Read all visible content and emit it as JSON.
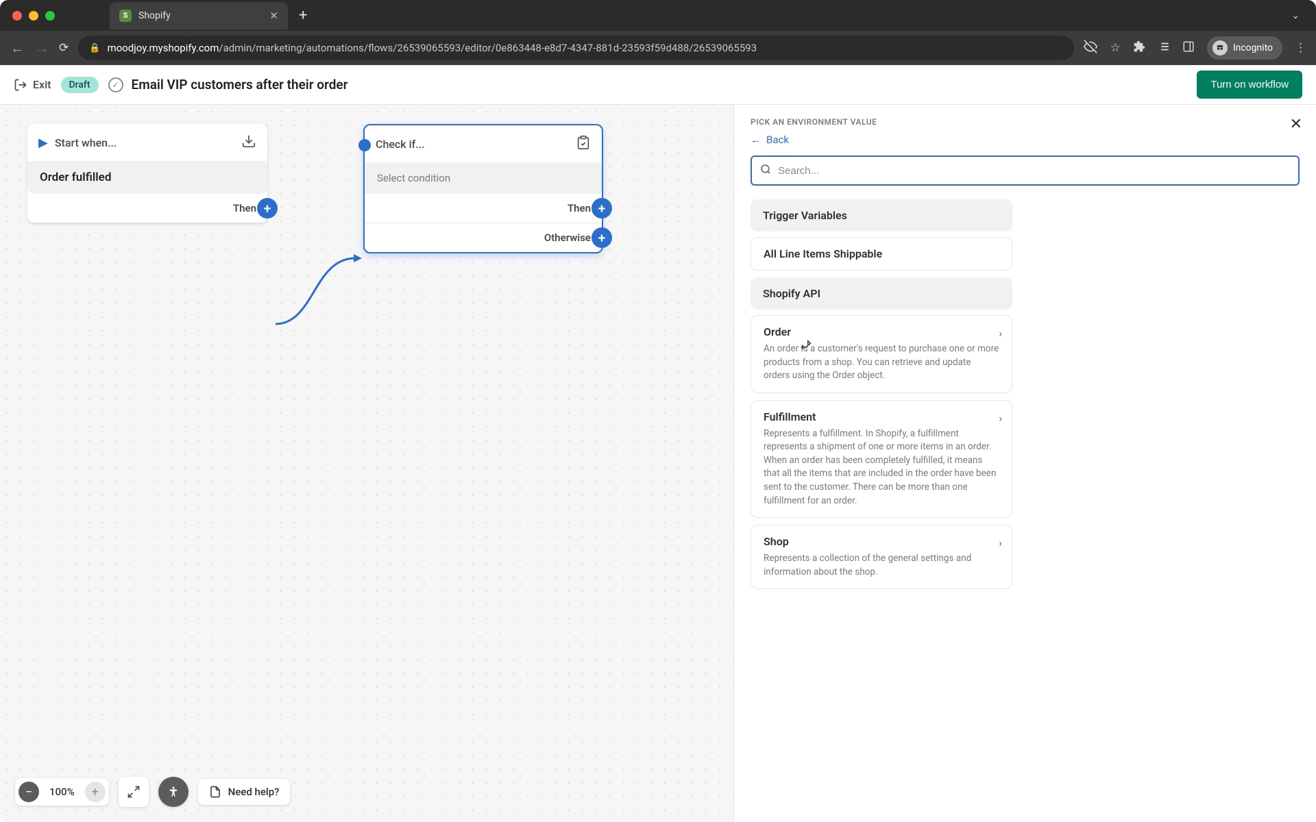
{
  "browser": {
    "tab_title": "Shopify",
    "url_prefix": "moodjoy.myshopify.com",
    "url_path": "/admin/marketing/automations/flows/26539065593/editor/0e863448-e8d7-4347-881d-23593f59d488/26539065593",
    "incognito_label": "Incognito"
  },
  "header": {
    "exit_label": "Exit",
    "draft_label": "Draft",
    "workflow_title": "Email VIP customers after their order",
    "turn_on_label": "Turn on workflow"
  },
  "canvas": {
    "start_node": {
      "header": "Start when...",
      "body": "Order fulfilled",
      "out_label": "Then"
    },
    "condition_node": {
      "header": "Check if...",
      "body": "Select condition",
      "then_label": "Then",
      "otherwise_label": "Otherwise"
    }
  },
  "zoom": {
    "level": "100%",
    "need_help": "Need help?"
  },
  "panel": {
    "subtitle": "PICK AN ENVIRONMENT VALUE",
    "back_label": "Back",
    "search_placeholder": "Search...",
    "sections": {
      "trigger": "Trigger Variables",
      "api": "Shopify API"
    },
    "items": {
      "all_line_items": {
        "name": "All Line Items Shippable"
      },
      "order": {
        "name": "Order",
        "desc": "An order is a customer's request to purchase one or more products from a shop. You can retrieve and update orders using the Order object."
      },
      "fulfillment": {
        "name": "Fulfillment",
        "desc": "Represents a fulfillment. In Shopify, a fulfillment represents a shipment of one or more items in an order. When an order has been completely fulfilled, it means that all the items that are included in the order have been sent to the customer. There can be more than one fulfillment for an order."
      },
      "shop": {
        "name": "Shop",
        "desc": "Represents a collection of the general settings and information about the shop."
      }
    }
  }
}
